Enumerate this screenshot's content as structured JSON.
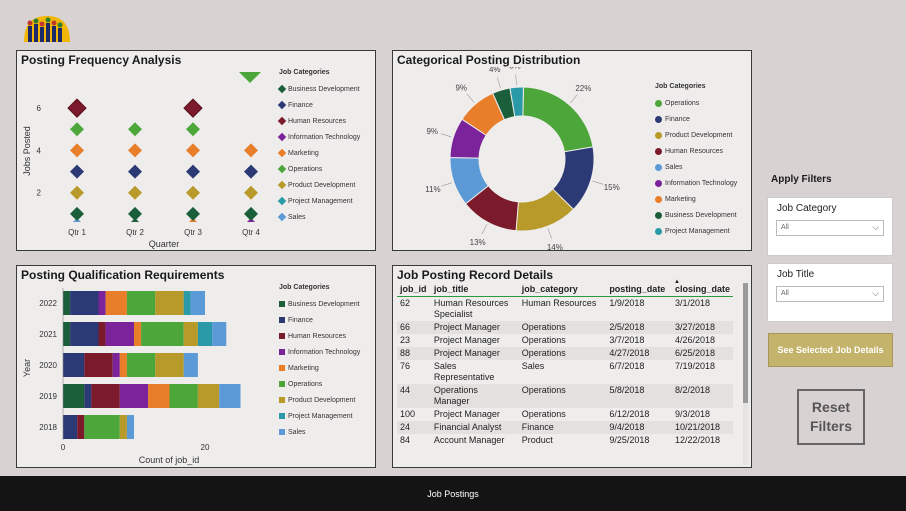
{
  "footer": {
    "label": "Job Postings"
  },
  "categories": [
    {
      "name": "Business Development",
      "color": "#1b5e3a"
    },
    {
      "name": "Finance",
      "color": "#2b3a74"
    },
    {
      "name": "Human Resources",
      "color": "#7a1a2a"
    },
    {
      "name": "Information Technology",
      "color": "#7a239a"
    },
    {
      "name": "Marketing",
      "color": "#e87e2a"
    },
    {
      "name": "Operations",
      "color": "#4ca63a"
    },
    {
      "name": "Product Development",
      "color": "#b89a2a"
    },
    {
      "name": "Project Management",
      "color": "#2a9aa8"
    },
    {
      "name": "Sales",
      "color": "#5b9ad6"
    }
  ],
  "freq": {
    "title": "Posting Frequency Analysis",
    "legend_title": "Job Categories",
    "chart_data": {
      "type": "scatter",
      "xlabel": "Quarter",
      "ylabel": "Jobs Posted",
      "categories": [
        "Qtr 1",
        "Qtr 2",
        "Qtr 3",
        "Qtr 4"
      ],
      "yticks": [
        "2",
        "4",
        "6"
      ],
      "ylim": [
        0,
        7
      ],
      "series": [
        {
          "name": "Human Resources",
          "values": [
            6,
            null,
            6,
            null
          ]
        },
        {
          "name": "Operations",
          "values": [
            5,
            5,
            5,
            null
          ]
        },
        {
          "name": "Marketing",
          "values": [
            4,
            4,
            4,
            4
          ]
        },
        {
          "name": "Finance",
          "values": [
            3,
            3,
            3,
            3
          ]
        },
        {
          "name": "Product Development",
          "values": [
            2,
            2,
            2,
            2
          ]
        },
        {
          "name": "Business Development",
          "values": [
            1,
            1,
            1,
            1
          ]
        }
      ]
    }
  },
  "dist": {
    "title": "Categorical Posting Distribution",
    "legend_title": "Job Categories",
    "legend": [
      "Operations",
      "Finance",
      "Product Development",
      "Human Resources",
      "Sales",
      "Information Technology",
      "Marketing",
      "Business Development",
      "Project Management"
    ],
    "chart_data": {
      "type": "pie",
      "labels": [
        "Operations",
        "Finance",
        "Product Development",
        "Human Resources",
        "Sales",
        "Information Technology",
        "Marketing",
        "Business Development",
        "Project Management"
      ],
      "values": [
        22,
        15,
        14,
        13,
        11,
        9,
        9,
        4,
        3
      ],
      "value_labels": [
        "22%",
        "15%",
        "14%",
        "13%",
        "11%",
        "9%",
        "9%",
        "4%",
        "3%"
      ]
    }
  },
  "qual": {
    "title": "Posting Qualification Requirements",
    "legend_title": "Job Categories",
    "chart_data": {
      "type": "bar",
      "orientation": "horizontal",
      "stacked": true,
      "xlabel": "Count of job_id",
      "ylabel": "Year",
      "xticks": [
        "0",
        "20"
      ],
      "xlim": [
        0,
        36
      ],
      "categories": [
        "2022",
        "2021",
        "2020",
        "2019",
        "2018"
      ],
      "series": [
        {
          "name": "Business Development",
          "values": [
            1,
            1,
            0,
            3,
            0
          ]
        },
        {
          "name": "Finance",
          "values": [
            4,
            4,
            3,
            1,
            2
          ]
        },
        {
          "name": "Human Resources",
          "values": [
            0,
            1,
            4,
            4,
            1
          ]
        },
        {
          "name": "Information Technology",
          "values": [
            1,
            4,
            1,
            4,
            0
          ]
        },
        {
          "name": "Marketing",
          "values": [
            3,
            1,
            1,
            3,
            0
          ]
        },
        {
          "name": "Operations",
          "values": [
            4,
            6,
            4,
            4,
            5
          ]
        },
        {
          "name": "Product Development",
          "values": [
            4,
            2,
            4,
            3,
            1
          ]
        },
        {
          "name": "Project Management",
          "values": [
            1,
            2,
            0,
            0,
            0
          ]
        },
        {
          "name": "Sales",
          "values": [
            2,
            2,
            2,
            3,
            1
          ]
        }
      ]
    }
  },
  "records": {
    "title": "Job Posting Record Details",
    "columns": [
      "job_id",
      "job_title",
      "job_category",
      "posting_date",
      "closing_date"
    ],
    "rows": [
      [
        "62",
        "Human Resources Specialist",
        "Human Resources",
        "1/9/2018",
        "3/1/2018"
      ],
      [
        "66",
        "Project Manager",
        "Operations",
        "2/5/2018",
        "3/27/2018"
      ],
      [
        "23",
        "Project Manager",
        "Operations",
        "3/7/2018",
        "4/26/2018"
      ],
      [
        "88",
        "Project Manager",
        "Operations",
        "4/27/2018",
        "6/25/2018"
      ],
      [
        "76",
        "Sales Representative",
        "Sales",
        "6/7/2018",
        "7/19/2018"
      ],
      [
        "44",
        "Operations Manager",
        "Operations",
        "5/8/2018",
        "8/2/2018"
      ],
      [
        "100",
        "Project Manager",
        "Operations",
        "6/12/2018",
        "9/3/2018"
      ],
      [
        "24",
        "Financial Analyst",
        "Finance",
        "9/4/2018",
        "10/21/2018"
      ],
      [
        "84",
        "Account Manager",
        "Product",
        "9/25/2018",
        "12/22/2018"
      ]
    ]
  },
  "filters": {
    "heading": "Apply Filters",
    "job_category": {
      "label": "Job Category",
      "value": "All"
    },
    "job_title": {
      "label": "Job Title",
      "value": "All"
    },
    "see_details": "See Selected Job Details",
    "reset": "Reset Filters"
  }
}
